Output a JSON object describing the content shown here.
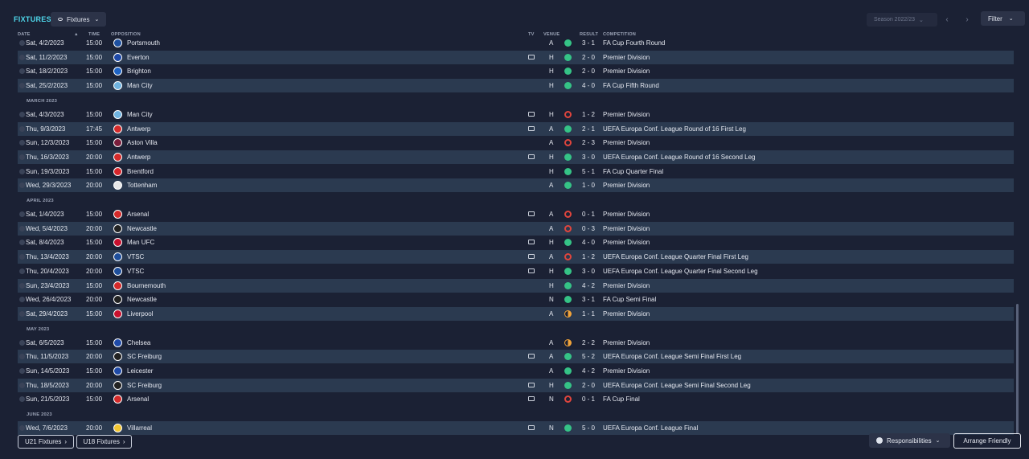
{
  "header": {
    "title": "FIXTURES",
    "view_dropdown": "Fixtures",
    "season": "Season 2022/23",
    "filter": "Filter"
  },
  "columns": {
    "date": "DATE",
    "time": "TIME",
    "opposition": "OPPOSITION",
    "tv": "TV",
    "venue": "VENUE",
    "result": "RESULT",
    "competition": "COMPETITION"
  },
  "months": [
    "MARCH 2023",
    "APRIL 2023",
    "MAY 2023",
    "JUNE 2023"
  ],
  "fixtures": [
    {
      "date": "Sat, 4/2/2023",
      "time": "15:00",
      "opp": "Portsmouth",
      "tv": false,
      "venue": "A",
      "outcome": "W",
      "result": "3 - 1",
      "comp": "FA Cup Fourth Round",
      "crest": "#1e50a0"
    },
    {
      "date": "Sat, 11/2/2023",
      "time": "15:00",
      "opp": "Everton",
      "tv": true,
      "venue": "H",
      "outcome": "W",
      "result": "2 - 0",
      "comp": "Premier Division",
      "crest": "#1f4aa8"
    },
    {
      "date": "Sat, 18/2/2023",
      "time": "15:00",
      "opp": "Brighton",
      "tv": false,
      "venue": "H",
      "outcome": "W",
      "result": "2 - 0",
      "comp": "Premier Division",
      "crest": "#1e63c4"
    },
    {
      "date": "Sat, 25/2/2023",
      "time": "15:00",
      "opp": "Man City",
      "tv": false,
      "venue": "H",
      "outcome": "W",
      "result": "4 - 0",
      "comp": "FA Cup Fifth Round",
      "crest": "#6fb3e0"
    },
    {
      "date": "Sat, 4/3/2023",
      "time": "15:00",
      "opp": "Man City",
      "tv": true,
      "venue": "H",
      "outcome": "L",
      "result": "1 - 2",
      "comp": "Premier Division",
      "crest": "#6fb3e0"
    },
    {
      "date": "Thu, 9/3/2023",
      "time": "17:45",
      "opp": "Antwerp",
      "tv": true,
      "venue": "A",
      "outcome": "W",
      "result": "2 - 1",
      "comp": "UEFA Europa Conf. League Round of 16  First Leg",
      "crest": "#d42a2a"
    },
    {
      "date": "Sun, 12/3/2023",
      "time": "15:00",
      "opp": "Aston Villa",
      "tv": false,
      "venue": "A",
      "outcome": "L",
      "result": "2 - 3",
      "comp": "Premier Division",
      "crest": "#7a1e3c"
    },
    {
      "date": "Thu, 16/3/2023",
      "time": "20:00",
      "opp": "Antwerp",
      "tv": true,
      "venue": "H",
      "outcome": "W",
      "result": "3 - 0",
      "comp": "UEFA Europa Conf. League Round of 16  Second Leg",
      "crest": "#d42a2a"
    },
    {
      "date": "Sun, 19/3/2023",
      "time": "15:00",
      "opp": "Brentford",
      "tv": false,
      "venue": "H",
      "outcome": "W",
      "result": "5 - 1",
      "comp": "FA Cup Quarter Final",
      "crest": "#d8262b"
    },
    {
      "date": "Wed, 29/3/2023",
      "time": "20:00",
      "opp": "Tottenham",
      "tv": false,
      "venue": "A",
      "outcome": "W",
      "result": "1 - 0",
      "comp": "Premier Division",
      "crest": "#e8e8e8"
    },
    {
      "date": "Sat, 1/4/2023",
      "time": "15:00",
      "opp": "Arsenal",
      "tv": true,
      "venue": "A",
      "outcome": "L",
      "result": "0 - 1",
      "comp": "Premier Division",
      "crest": "#d42a2a"
    },
    {
      "date": "Wed, 5/4/2023",
      "time": "20:00",
      "opp": "Newcastle",
      "tv": false,
      "venue": "A",
      "outcome": "L",
      "result": "0 - 3",
      "comp": "Premier Division",
      "crest": "#222222"
    },
    {
      "date": "Sat, 8/4/2023",
      "time": "15:00",
      "opp": "Man UFC",
      "tv": true,
      "venue": "H",
      "outcome": "W",
      "result": "4 - 0",
      "comp": "Premier Division",
      "crest": "#c8102e"
    },
    {
      "date": "Thu, 13/4/2023",
      "time": "20:00",
      "opp": "VTSC",
      "tv": true,
      "venue": "A",
      "outcome": "L",
      "result": "1 - 2",
      "comp": "UEFA Europa Conf. League Quarter Final First Leg",
      "crest": "#1f4f9c"
    },
    {
      "date": "Thu, 20/4/2023",
      "time": "20:00",
      "opp": "VTSC",
      "tv": true,
      "venue": "H",
      "outcome": "W",
      "result": "3 - 0",
      "comp": "UEFA Europa Conf. League Quarter Final Second Leg",
      "crest": "#1f4f9c"
    },
    {
      "date": "Sun, 23/4/2023",
      "time": "15:00",
      "opp": "Bournemouth",
      "tv": false,
      "venue": "H",
      "outcome": "W",
      "result": "4 - 2",
      "comp": "Premier Division",
      "crest": "#d42a2a"
    },
    {
      "date": "Wed, 26/4/2023",
      "time": "20:00",
      "opp": "Newcastle",
      "tv": false,
      "venue": "N",
      "outcome": "W",
      "result": "3 - 1",
      "comp": "FA Cup Semi Final",
      "crest": "#222222"
    },
    {
      "date": "Sat, 29/4/2023",
      "time": "15:00",
      "opp": "Liverpool",
      "tv": false,
      "venue": "A",
      "outcome": "D",
      "result": "1 - 1",
      "comp": "Premier Division",
      "crest": "#c8102e"
    },
    {
      "date": "Sat, 6/5/2023",
      "time": "15:00",
      "opp": "Chelsea",
      "tv": false,
      "venue": "A",
      "outcome": "D",
      "result": "2 - 2",
      "comp": "Premier Division",
      "crest": "#1f4aa8"
    },
    {
      "date": "Thu, 11/5/2023",
      "time": "20:00",
      "opp": "SC Freiburg",
      "tv": true,
      "venue": "A",
      "outcome": "W",
      "result": "5 - 2",
      "comp": "UEFA Europa Conf. League Semi Final First Leg",
      "crest": "#222222"
    },
    {
      "date": "Sun, 14/5/2023",
      "time": "15:00",
      "opp": "Leicester",
      "tv": false,
      "venue": "A",
      "outcome": "W",
      "result": "4 - 2",
      "comp": "Premier Division",
      "crest": "#1f4aa8"
    },
    {
      "date": "Thu, 18/5/2023",
      "time": "20:00",
      "opp": "SC Freiburg",
      "tv": true,
      "venue": "H",
      "outcome": "W",
      "result": "2 - 0",
      "comp": "UEFA Europa Conf. League Semi Final Second Leg",
      "crest": "#222222"
    },
    {
      "date": "Sun, 21/5/2023",
      "time": "15:00",
      "opp": "Arsenal",
      "tv": true,
      "venue": "N",
      "outcome": "L",
      "result": "0 - 1",
      "comp": "FA Cup Final",
      "crest": "#d42a2a"
    },
    {
      "date": "Wed, 7/6/2023",
      "time": "20:00",
      "opp": "Villarreal",
      "tv": true,
      "venue": "N",
      "outcome": "W",
      "result": "5 - 0",
      "comp": "UEFA Europa Conf. League Final",
      "crest": "#f2c531"
    }
  ],
  "footer": {
    "u21": "U21 Fixtures",
    "u18": "U18 Fixtures",
    "responsibilities": "Responsibilities",
    "arrange": "Arrange Friendly"
  },
  "colors": {
    "accent": "#4fd8ec",
    "win": "#35c386",
    "loss": "#e0453d",
    "draw": "#f2a43a"
  }
}
